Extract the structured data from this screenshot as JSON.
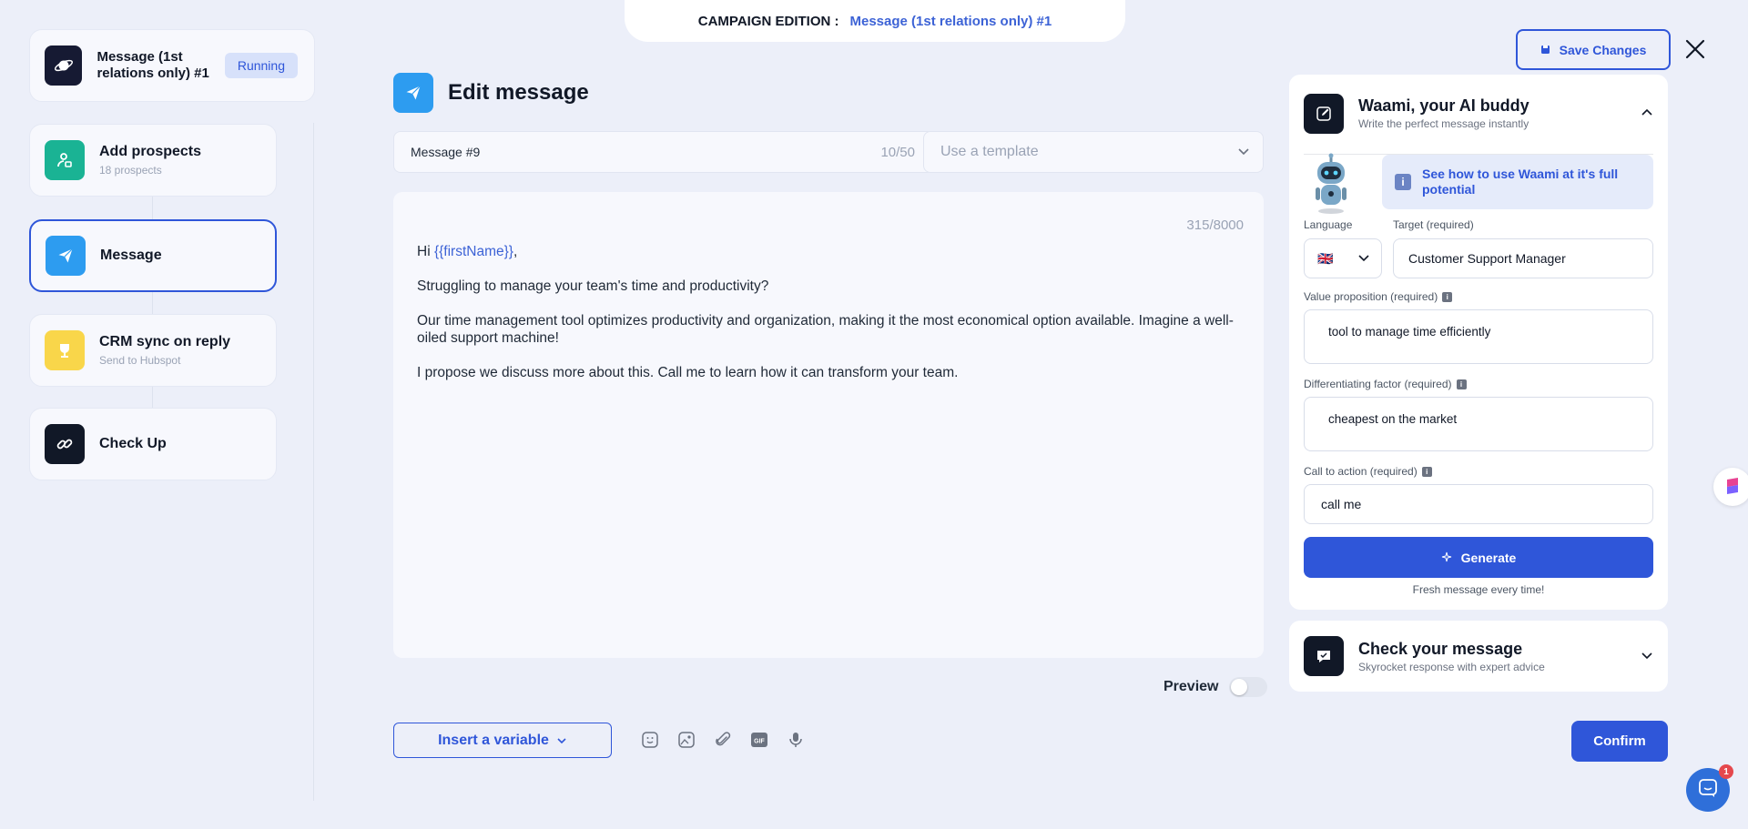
{
  "header": {
    "prefix": "CAMPAIGN EDITION :",
    "campaign_name": "Message (1st relations only) #1"
  },
  "sidebar": {
    "campaign": {
      "title": "Message (1st relations only) #1",
      "status": "Running"
    },
    "steps": [
      {
        "title": "Add prospects",
        "subtitle": "18 prospects",
        "color": "#1ab394",
        "icon": "user-add-icon"
      },
      {
        "title": "Message",
        "subtitle": "",
        "color": "#2d9cf0",
        "icon": "send-icon"
      },
      {
        "title": "CRM sync on reply",
        "subtitle": "Send to Hubspot",
        "color": "#f9d64a",
        "icon": "trophy-icon"
      },
      {
        "title": "Check Up",
        "subtitle": "",
        "color": "#111827",
        "icon": "link-icon"
      }
    ]
  },
  "editor": {
    "title": "Edit message",
    "name_value": "Message #9",
    "name_count": "10/50",
    "template_placeholder": "Use a template",
    "char_count": "315/8000",
    "greeting": "Hi ",
    "variable": "{{firstName}}",
    "greeting_end": ",",
    "para1": "Struggling to manage your team's time and productivity?",
    "para2": "Our time management tool optimizes productivity and organization, making it the most economical option available. Imagine a well-oiled support machine!",
    "para3": "I propose we discuss more about this. Call me to learn how it can transform your team.",
    "preview_label": "Preview",
    "insert_variable": "Insert a variable"
  },
  "toolbar": {
    "save_changes": "Save Changes",
    "confirm": "Confirm"
  },
  "waami": {
    "title": "Waami, your AI buddy",
    "subtitle": "Write the perfect message instantly",
    "info_link": "See how to use Waami at it's full potential",
    "language_label": "Language",
    "language_flag": "🇬🇧",
    "target_label": "Target (required)",
    "target_value": "Customer Support Manager",
    "value_prop_label": "Value proposition (required)",
    "value_prop_value": "tool to manage time efficiently",
    "diff_label": "Differentiating factor (required)",
    "diff_value": "cheapest on the market",
    "cta_label": "Call to action (required)",
    "cta_value": "call me",
    "generate": "Generate",
    "generate_hint": "Fresh message every time!"
  },
  "check": {
    "title": "Check your message",
    "subtitle": "Skyrocket response with expert advice"
  },
  "chat": {
    "badge": "1"
  },
  "colors": {
    "accent": "#2f56d9",
    "link": "#3d63d6",
    "background": "#eceff9"
  }
}
